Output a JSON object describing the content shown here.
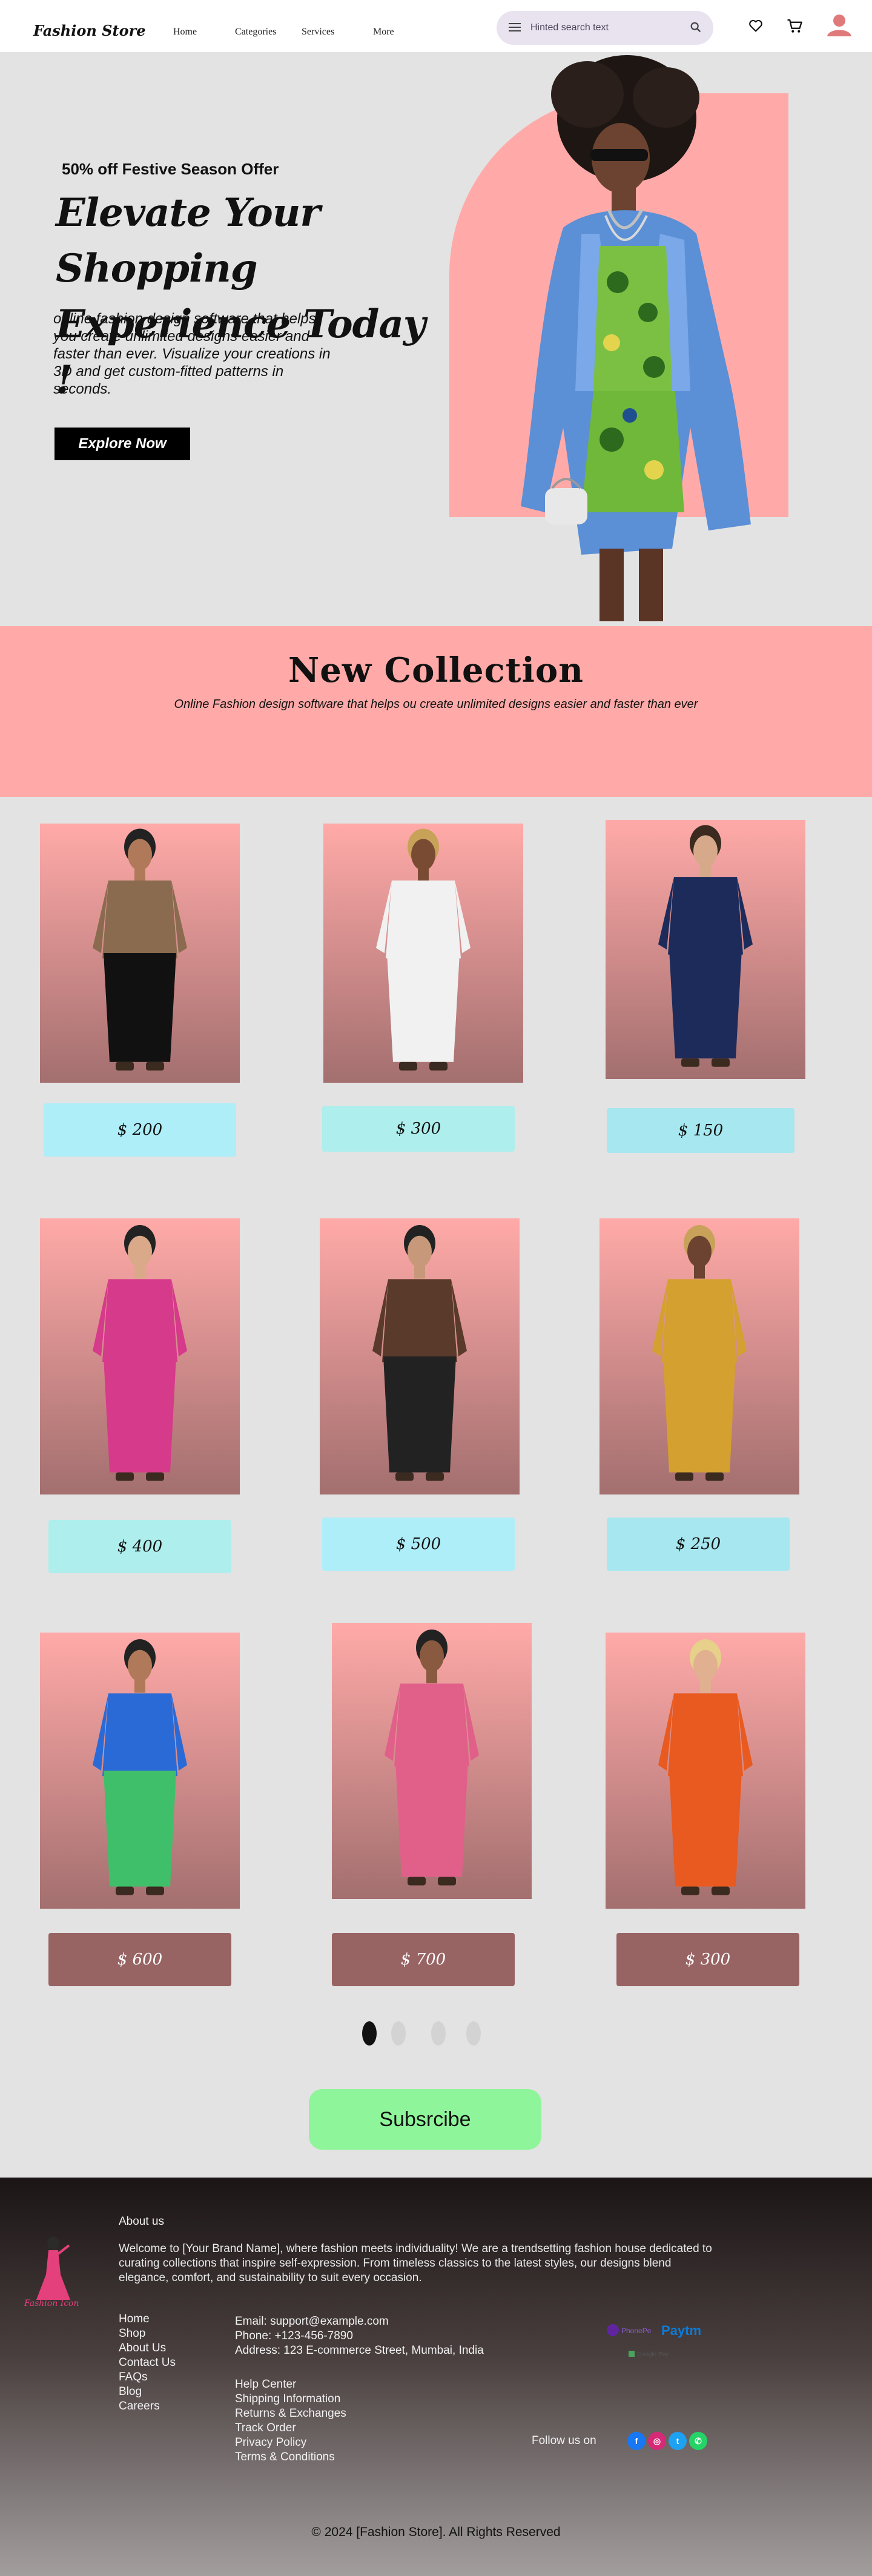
{
  "nav": {
    "brand": "Fashion Store",
    "links": [
      "Home",
      "Categories",
      "Services",
      "More"
    ],
    "search_placeholder": "Hinted search text"
  },
  "hero": {
    "offer": "50% off Festive Season Offer",
    "title_line1": "Elevate Your Shopping",
    "title_line2": "Experience Today !",
    "description": "online fashion design software that helps you create unlimited designs easier and faster than ever. Visualize your creations in 3D and get custom-fitted patterns in seconds.",
    "cta": "Explore Now"
  },
  "collection": {
    "title": "New Collection",
    "subtitle": "Online Fashion design software that helps ou create unlimited designs easier and faster than ever"
  },
  "products": [
    {
      "price": "$ 200",
      "figure": "woman-brown-blouse",
      "button": "cyan"
    },
    {
      "price": "$ 300",
      "figure": "woman-white-gown",
      "button": "mint"
    },
    {
      "price": "$ 150",
      "figure": "man-navy-suit",
      "button": "teal"
    },
    {
      "price": "$ 400",
      "figure": "woman-pink-suit",
      "button": "mint"
    },
    {
      "price": "$ 500",
      "figure": "man-aviator-jacket",
      "button": "cyan"
    },
    {
      "price": "$ 250",
      "figure": "man-mustard-suit",
      "button": "teal"
    },
    {
      "price": "$ 600",
      "figure": "woman-maxi-dress",
      "button": "brown"
    },
    {
      "price": "$ 700",
      "figure": "woman-pink-pantsuit",
      "button": "brown"
    },
    {
      "price": "$ 300",
      "figure": "woman-orange-jumpsuit",
      "button": "brown"
    }
  ],
  "carousel": {
    "count": 4,
    "active": 0
  },
  "subscribe_label": "Subsrcibe",
  "footer": {
    "logo_text": "Fashion Icon",
    "about_heading": "About us",
    "about_text": "Welcome to [Your Brand Name], where fashion meets individuality! We are a trendsetting fashion house dedicated to curating collections that inspire self-expression. From timeless classics to the latest styles, our designs blend elegance, comfort, and sustainability to suit every occasion.",
    "links": [
      "Home",
      "Shop",
      "About Us",
      "Contact Us",
      "FAQs",
      "Blog",
      "Careers"
    ],
    "email": "Email: support@example.com",
    "phone": "Phone: +123-456-7890",
    "address": "Address: 123 E-commerce Street, Mumbai, India",
    "help_links": [
      "Help Center",
      "Shipping Information",
      "Returns & Exchanges",
      "Track Order",
      "Privacy Policy",
      "Terms & Conditions"
    ],
    "payments": [
      "PhonePe",
      "Paytm",
      "Google Pay"
    ],
    "follow_label": "Follow us on",
    "socials": [
      "facebook",
      "instagram",
      "twitter",
      "whatsapp"
    ],
    "copyright": "© 2024 [Fashion Store]. All Rights Reserved"
  },
  "colors": {
    "accent_pink": "#ffaaa8",
    "gradient_bottom": "#a36f6f",
    "subscribe_green": "#8ff59a",
    "price_cyan": "#aeeef9",
    "price_brown": "#986363"
  }
}
